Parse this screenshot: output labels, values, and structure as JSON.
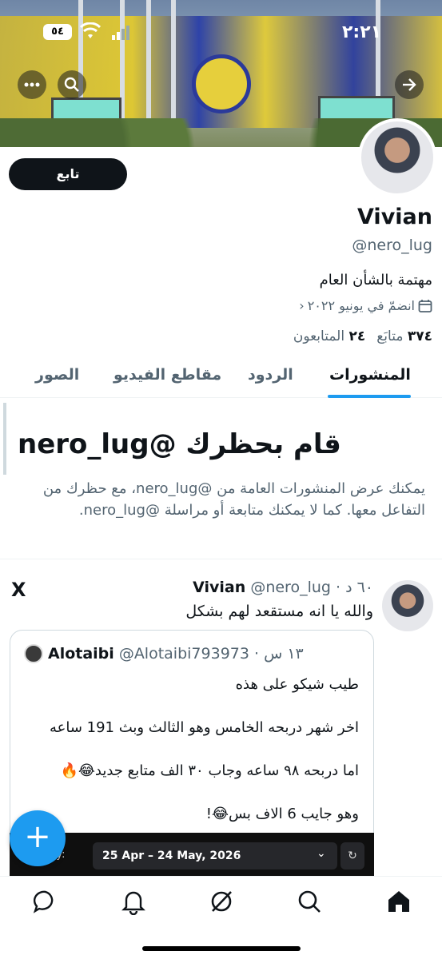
{
  "status_bar": {
    "time": "٢:٢١",
    "battery": "٥٤"
  },
  "banner": {
    "back_icon": "arrow-right-icon",
    "search_icon": "search-icon",
    "more_icon": "more-icon"
  },
  "profile": {
    "follow_label": "تابع",
    "name": "Vivian",
    "handle": "@nero_lug",
    "bio": "مهتمة بالشأن العام",
    "joined": "انضمّ في يونيو ٢٠٢٢",
    "following_count": "٣٧٤",
    "following_label": "متابَع",
    "followers_count": "٢٤",
    "followers_label": "المتابعون"
  },
  "tabs": [
    {
      "label": "المنشورات"
    },
    {
      "label": "الردود"
    },
    {
      "label": "مقاطع الفيديو"
    },
    {
      "label": "الصور"
    }
  ],
  "blocked": {
    "title": "قام بحظرك @nero_lug",
    "line1": "يمكنك عرض المنشورات العامة من @nero_lug، مع حظرك من",
    "line2": "التفاعل معها. كما لا يمكنك متابعة أو مراسلة @nero_lug."
  },
  "tweet": {
    "name": "Vivian",
    "handle_time": "@nero_lug · ٦٠ د",
    "text": "والله يا انه مستقعد لهم بشكل",
    "source_logo": "X",
    "quote": {
      "name": "Alotaibi",
      "handle_time": "@Alotaibi793973 · ١٣ س",
      "lines": [
        "طيب شيكو على هذه",
        "اخر شهر دربحه الخامس وهو الثالث وبث 191 ساعه",
        "اما دربحه ٩٨ ساعه وجاب ٣٠ الف متابع جديد😂🔥",
        "وهو جايب 6 الاف بس😂!"
      ],
      "date_label": "e by:",
      "date_range": "25 Apr – 24 May, 2026"
    }
  },
  "nav": [
    "home-icon",
    "search-icon",
    "grok-icon",
    "notifications-icon",
    "messages-icon"
  ]
}
